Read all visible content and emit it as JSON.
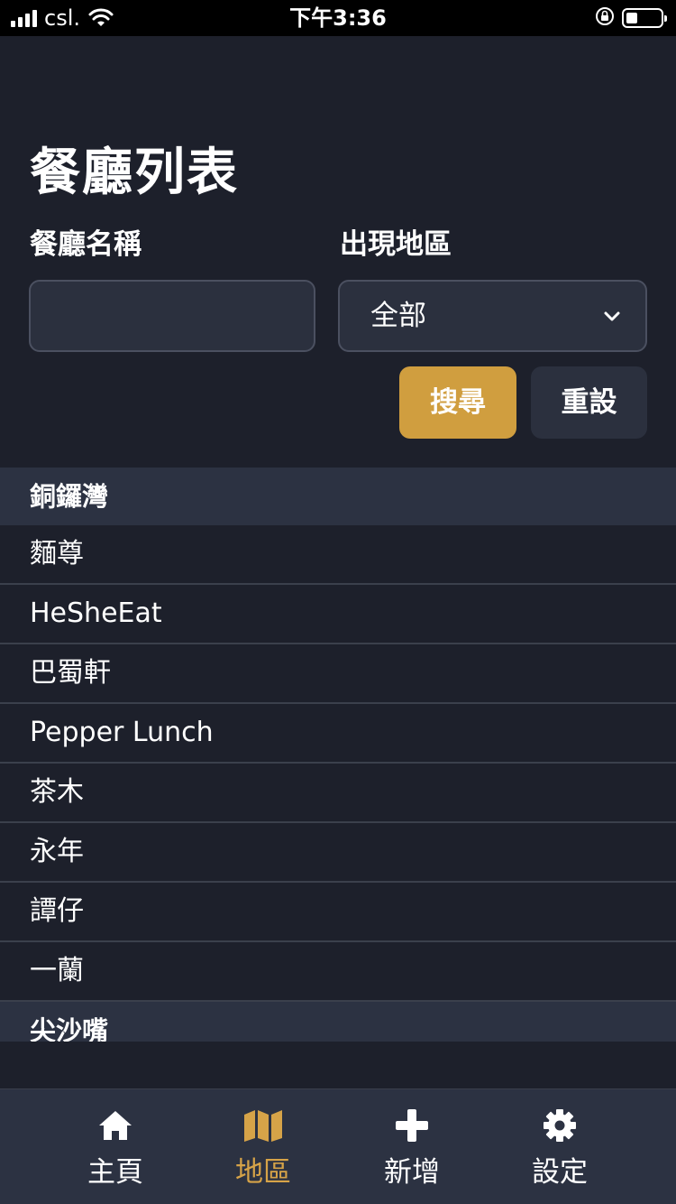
{
  "status_bar": {
    "carrier": "csl.",
    "time": "下午3:36"
  },
  "page": {
    "title": "餐廳列表"
  },
  "filters": {
    "name_label": "餐廳名稱",
    "name_value": "",
    "region_label": "出現地區",
    "region_selected": "全部",
    "search_label": "搜尋",
    "reset_label": "重設"
  },
  "sections": [
    {
      "title": "銅鑼灣",
      "items": [
        "麵尊",
        "HeSheEat",
        "巴蜀軒",
        "Pepper Lunch",
        "茶木",
        "永年",
        "譚仔",
        "一蘭"
      ]
    },
    {
      "title": "尖沙嘴",
      "items": []
    }
  ],
  "tabs": [
    {
      "label": "主頁",
      "icon": "home-icon",
      "active": false
    },
    {
      "label": "地區",
      "icon": "map-icon",
      "active": true
    },
    {
      "label": "新增",
      "icon": "plus-icon",
      "active": false
    },
    {
      "label": "設定",
      "icon": "gear-icon",
      "active": false
    }
  ],
  "colors": {
    "background": "#1d202b",
    "panel": "#2c3242",
    "accent": "#d09e3f",
    "active_tab": "#d6a348"
  }
}
